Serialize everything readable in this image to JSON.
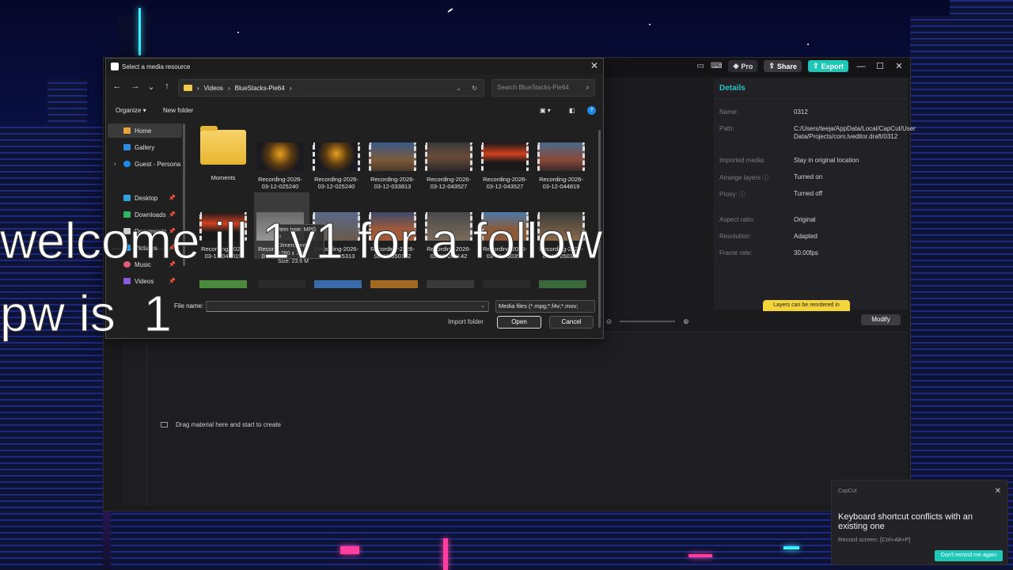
{
  "dialog": {
    "title": "Select a media resource",
    "breadcrumb": [
      "Videos",
      "BlueStacks-Pie64"
    ],
    "search_placeholder": "Search BlueStacks-Pie64",
    "organize_label": "Organize ▾",
    "new_folder_label": "New folder",
    "nav_items": [
      {
        "label": "Home",
        "color": "#e8a33b"
      },
      {
        "label": "Gallery",
        "color": "#2f8be0"
      },
      {
        "label": "Guest - Persona",
        "color": "#1e88e5"
      },
      {
        "label": "Desktop",
        "color": "#33a0e0"
      },
      {
        "label": "Downloads",
        "color": "#2fb46a"
      },
      {
        "label": "Documents",
        "color": "#cccccc"
      },
      {
        "label": "Pictures",
        "color": "#3a9be0"
      },
      {
        "label": "Music",
        "color": "#e05a7a"
      },
      {
        "label": "Videos",
        "color": "#8a5ae0"
      }
    ],
    "files_row1": [
      {
        "name": "Moments",
        "kind": "folder"
      },
      {
        "name": "Recording-2026-03-12-025240",
        "kind": "video"
      },
      {
        "name": "Recording-2026-03-12-025240",
        "kind": "video"
      },
      {
        "name": "Recording-2026-03-12-033813",
        "kind": "video"
      },
      {
        "name": "Recording-2026-03-12-043527",
        "kind": "video"
      },
      {
        "name": "Recording-2026-03-12-043527",
        "kind": "video"
      },
      {
        "name": "Recording-2026-03-12-044819",
        "kind": "video"
      }
    ],
    "files_row2": [
      {
        "name": "Recording-2026-03-12-044819",
        "kind": "video"
      },
      {
        "name": "Recording-2026-03-12-045313",
        "kind": "video"
      },
      {
        "name": "Recording-2026-03-12-045313",
        "kind": "video"
      },
      {
        "name": "Recording-2026-03-12-050142",
        "kind": "video"
      },
      {
        "name": "Recording-2026-03-12-050142",
        "kind": "video"
      },
      {
        "name": "Recording-2026-03-12-050351",
        "kind": "video"
      },
      {
        "name": "Recording-2026-03-12-050351",
        "kind": "video"
      }
    ],
    "tooltip": {
      "line1": "Item type: MPG F",
      "line2": "Dimensions: 1280 x 720",
      "line3": "Size: 23.6 M"
    },
    "file_name_label": "File name:",
    "file_type": "Media files (*.mpg;*.f4v;*.mov;",
    "import_folder_label": "Import folder",
    "open_label": "Open",
    "cancel_label": "Cancel"
  },
  "capcut": {
    "pro_label": "Pro",
    "share_label": "Share",
    "export_label": "Export",
    "details_title": "Details",
    "details": [
      {
        "label": "Name:",
        "value": "0312"
      },
      {
        "label": "Path:",
        "value": "C:/Users/teeja/AppData/Local/CapCut/User Data/Projects/com.lveditor.draft/0312"
      },
      {
        "label": "Imported media:",
        "value": "Stay in original location"
      },
      {
        "label": "Arrange layers ⓘ",
        "value": "Turned on"
      },
      {
        "label": "Proxy: ⓘ",
        "value": "Turned off"
      },
      {
        "label": "Aspect ratio:",
        "value": "Original"
      },
      {
        "label": "Resolution:",
        "value": "Adapted"
      },
      {
        "label": "Frame rate:",
        "value": "30.00fps"
      }
    ],
    "modify_label": "Modify",
    "layers_tip": "Layers can be reordered in",
    "drag_hint": "Drag material here and start to create"
  },
  "overlay": {
    "line1": "welcome ill 1v1 for a follow",
    "line2": "pw is  1"
  },
  "toast": {
    "app_name": "CapCut",
    "message": "Keyboard shortcut conflicts with an existing one",
    "detail": "Record screen: [Ctrl+Alt+P]",
    "dismiss_label": "Don't remind me again"
  }
}
